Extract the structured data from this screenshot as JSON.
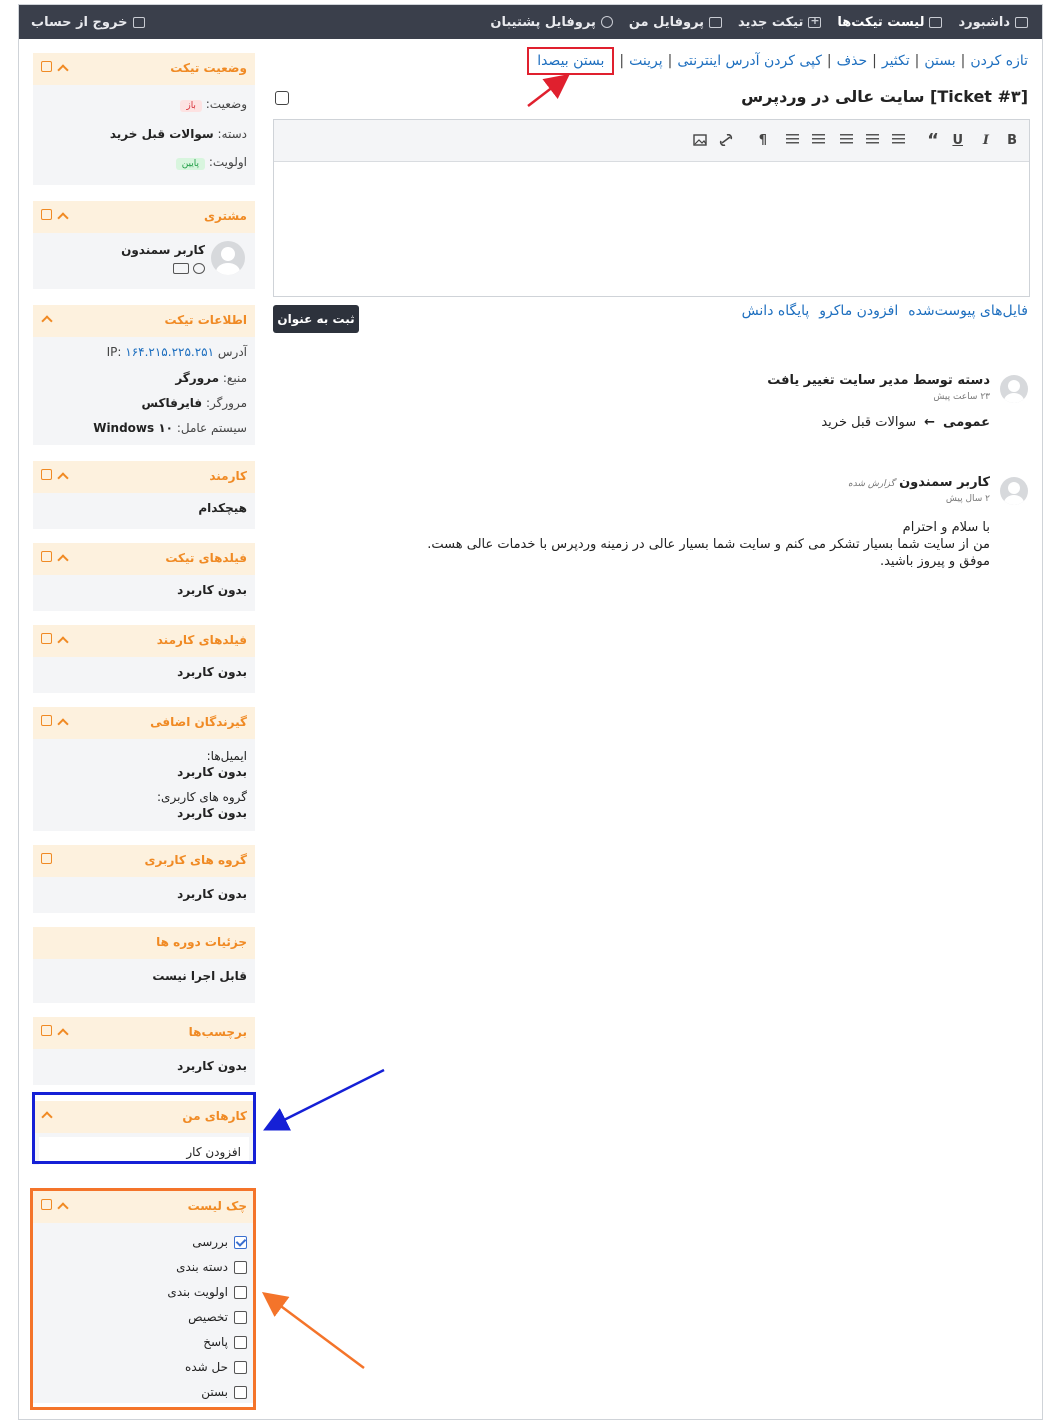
{
  "nav": {
    "items": [
      {
        "label": "داشبورد",
        "icon": "dashboard-icon"
      },
      {
        "label": "لیست تیکت‌ها",
        "icon": "list-icon",
        "active": true
      },
      {
        "label": "تیکت جدید",
        "icon": "plus-icon"
      },
      {
        "label": "پروفایل من",
        "icon": "profile-icon"
      },
      {
        "label": "پروفایل پشتیبان",
        "icon": "headset-icon"
      }
    ],
    "logout_label": "خروج از حساب"
  },
  "actions": {
    "items": [
      "تازه کردن",
      "بستن",
      "تکثیر",
      "حذف",
      "کپی کردن آدرس اینترنتی",
      "پرینت"
    ],
    "silent_close": "بستن بیصدا"
  },
  "ticket": {
    "title": "[Ticket #۳] سایت عالی در وردپرس"
  },
  "editor": {
    "toolbar": [
      "B",
      "I",
      "U",
      "blockquote",
      "align-left",
      "align-center",
      "align-right",
      "bullet-list",
      "numbered-list",
      "paragraph-direction",
      "link",
      "image"
    ],
    "submit_label": "ثبت به عنوان",
    "links": [
      "فایل‌های پیوست‌شده",
      "افزودن ماکرو",
      "پایگاه دانش"
    ]
  },
  "history": {
    "category_change": {
      "title": "دسته توسط مدیر سایت تغییر یافت",
      "time": "۲۳ ساعت پیش",
      "from": "عمومی",
      "to": "سوالات قبل خرید"
    },
    "message": {
      "author": "کاربر سمندون",
      "tag": "گزارش شده",
      "time": "۲ سال پیش",
      "lines": [
        "با سلام و احترام",
        "من از سایت شما بسیار تشکر می کنم و سایت شما بسیار عالی در زمینه وردپرس با خدمات عالی هست.",
        "موفق و پیروز باشید."
      ]
    }
  },
  "sidebar": {
    "status": {
      "title": "وضعیت تیکت",
      "status_label": "وضعیت:",
      "status_value": "باز",
      "category_label": "دسته:",
      "category_value": "سوالات قبل خرید",
      "priority_label": "اولویت:",
      "priority_value": "پایین"
    },
    "customer": {
      "title": "مشتری",
      "name": "کاربر سمندون"
    },
    "info": {
      "title": "اطلاعات تیکت",
      "ip_label": "آدرس IP:",
      "ip_value": "۱۶۴.۲۱۵.۲۲۵.۲۵۱",
      "source_label": "منبع:",
      "source_value": "مرورگر",
      "browser_label": "مرورگر:",
      "browser_value": "فایرفاکس",
      "os_label": "سیستم عامل:",
      "os_value": "Windows ۱۰"
    },
    "agent": {
      "title": "کارمند",
      "value": "هیچکدام"
    },
    "ticket_fields": {
      "title": "فیلدهای تیکت",
      "value": "بدون کاربرد"
    },
    "agent_fields": {
      "title": "فیلدهای کارمند",
      "value": "بدون کاربرد"
    },
    "extra_recipients": {
      "title": "گیرندگان اضافی",
      "emails_label": "ایمیل‌ها:",
      "emails_value": "بدون کاربرد",
      "groups_label": "گروه های کاربری:",
      "groups_value": "بدون کاربرد"
    },
    "user_groups": {
      "title": "گروه های کاربری",
      "value": "بدون کاربرد"
    },
    "course_details": {
      "title": "جزئیات دوره ها",
      "value": "قابل اجرا نیست"
    },
    "tags": {
      "title": "برچسب‌ها",
      "value": "بدون کاربرد"
    },
    "my_tasks": {
      "title": "کارهای من",
      "add_label": "افزودن کار"
    },
    "checklist": {
      "title": "چک لیست",
      "items": [
        {
          "label": "بررسی",
          "checked": true
        },
        {
          "label": "دسته بندی",
          "checked": false
        },
        {
          "label": "اولویت بندی",
          "checked": false
        },
        {
          "label": "تخصیص",
          "checked": false
        },
        {
          "label": "پاسخ",
          "checked": false
        },
        {
          "label": "حل شده",
          "checked": false
        },
        {
          "label": "بستن",
          "checked": false
        }
      ]
    }
  },
  "annotations": {
    "red_box": "#e0202e",
    "blue_box": "#1520d6",
    "orange_box": "#f4742a"
  }
}
